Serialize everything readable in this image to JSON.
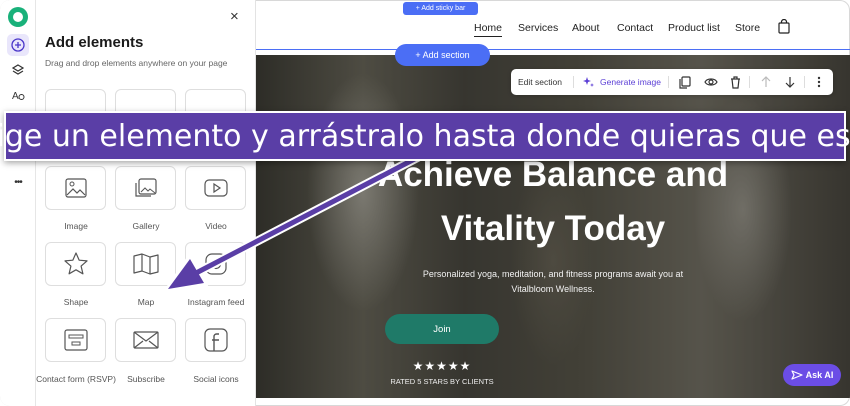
{
  "rail": {
    "icons": [
      "logo-icon",
      "plus-icon",
      "layers-icon",
      "text-style-icon",
      "more-icon"
    ],
    "more_label": "•••"
  },
  "panel": {
    "title": "Add elements",
    "subtitle": "Drag and drop elements anywhere on your page",
    "close_label": "×",
    "tiles": [
      {
        "label": "Image",
        "icon": "image-icon"
      },
      {
        "label": "Gallery",
        "icon": "gallery-icon"
      },
      {
        "label": "Video",
        "icon": "video-icon"
      },
      {
        "label": "Shape",
        "icon": "star-shape-icon"
      },
      {
        "label": "Map",
        "icon": "map-icon"
      },
      {
        "label": "Instagram feed",
        "icon": "instagram-icon"
      },
      {
        "label": "Contact form (RSVP)",
        "icon": "form-icon"
      },
      {
        "label": "Subscribe",
        "icon": "envelope-icon"
      },
      {
        "label": "Social icons",
        "icon": "facebook-icon"
      }
    ]
  },
  "header": {
    "sticky_bar_label": "+ Add sticky bar",
    "nav": [
      "Home",
      "Services",
      "About",
      "Contact",
      "Product list",
      "Store"
    ],
    "active_nav": "Home",
    "add_section_label": "+ Add section"
  },
  "toolbar": {
    "edit_section": "Edit section",
    "generate_image": "Generate image"
  },
  "hero": {
    "title_line1": "Achieve Balance and",
    "title_line2": "Vitality Today",
    "subtitle": "Personalized yoga, meditation, and fitness programs await you at Vitalbloom Wellness.",
    "cta": "Join",
    "stars": "★★★★★",
    "rating_text": "RATED 5 STARS BY CLIENTS"
  },
  "banner": {
    "text": "Elige un elemento y arrástralo hasta donde quieras que esté"
  },
  "ask_ai": {
    "label": "Ask AI"
  },
  "colors": {
    "brand_blue": "#4b6ef5",
    "banner_purple": "#5a3ea6",
    "cta_green": "#1f7a68",
    "ask_ai_purple": "#6b4de6"
  }
}
